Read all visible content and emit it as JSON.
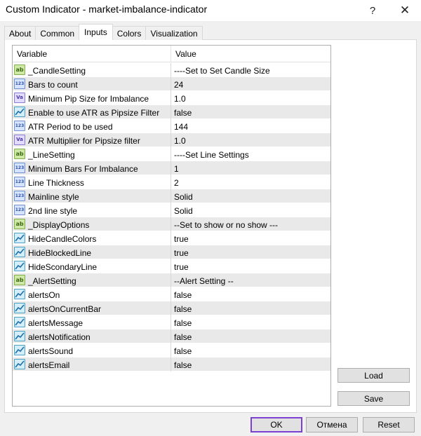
{
  "window": {
    "title": "Custom Indicator - market-imbalance-indicator",
    "help_glyph": "?",
    "close_glyph": "✕"
  },
  "tabs": [
    {
      "label": "About",
      "active": false
    },
    {
      "label": "Common",
      "active": false
    },
    {
      "label": "Inputs",
      "active": true
    },
    {
      "label": "Colors",
      "active": false
    },
    {
      "label": "Visualization",
      "active": false
    }
  ],
  "table": {
    "headers": {
      "variable": "Variable",
      "value": "Value"
    },
    "rows": [
      {
        "icon": "ab",
        "icon_text": "ab",
        "variable": "_CandleSetting",
        "value": "----Set to Set Candle Size"
      },
      {
        "icon": "num",
        "icon_text": "123",
        "variable": "Bars to count",
        "value": "24"
      },
      {
        "icon": "dbl",
        "icon_text": "Va",
        "variable": "Minimum Pip Size for Imbalance",
        "value": "1.0"
      },
      {
        "icon": "bool",
        "icon_text": "",
        "variable": "Enable to use ATR as Pipsize Filter",
        "value": "false"
      },
      {
        "icon": "num",
        "icon_text": "123",
        "variable": "ATR Period to be used",
        "value": "144"
      },
      {
        "icon": "dbl",
        "icon_text": "Va",
        "variable": "ATR Multiplier for Pipsize filter",
        "value": "1.0"
      },
      {
        "icon": "ab",
        "icon_text": "ab",
        "variable": "_LineSetting",
        "value": "----Set Line Settings"
      },
      {
        "icon": "num",
        "icon_text": "123",
        "variable": "Minimum Bars For Imbalance",
        "value": "1"
      },
      {
        "icon": "num",
        "icon_text": "123",
        "variable": "Line Thickness",
        "value": "2"
      },
      {
        "icon": "num",
        "icon_text": "123",
        "variable": "Mainline style",
        "value": "Solid"
      },
      {
        "icon": "num",
        "icon_text": "123",
        "variable": "2nd line style",
        "value": "Solid"
      },
      {
        "icon": "ab",
        "icon_text": "ab",
        "variable": "_DisplayOptions",
        "value": "--Set to show or no show ---"
      },
      {
        "icon": "bool",
        "icon_text": "",
        "variable": "HideCandleColors",
        "value": "true"
      },
      {
        "icon": "bool",
        "icon_text": "",
        "variable": "HideBlockedLine",
        "value": "true"
      },
      {
        "icon": "bool",
        "icon_text": "",
        "variable": "HideScondaryLine",
        "value": "true"
      },
      {
        "icon": "ab",
        "icon_text": "ab",
        "variable": "_AlertSetting",
        "value": "--Alert Setting --"
      },
      {
        "icon": "bool",
        "icon_text": "",
        "variable": "alertsOn",
        "value": "false"
      },
      {
        "icon": "bool",
        "icon_text": "",
        "variable": "alertsOnCurrentBar",
        "value": "false"
      },
      {
        "icon": "bool",
        "icon_text": "",
        "variable": "alertsMessage",
        "value": "false"
      },
      {
        "icon": "bool",
        "icon_text": "",
        "variable": "alertsNotification",
        "value": "false"
      },
      {
        "icon": "bool",
        "icon_text": "",
        "variable": "alertsSound",
        "value": "false"
      },
      {
        "icon": "bool",
        "icon_text": "",
        "variable": "alertsEmail",
        "value": "false"
      }
    ]
  },
  "side_buttons": {
    "load": "Load",
    "save": "Save"
  },
  "bottom_buttons": {
    "ok": "OK",
    "cancel": "Отмена",
    "reset": "Reset"
  },
  "colors": {
    "ok_focus_border": "#7b3fd1",
    "row_alt": "#e9e9e9"
  }
}
